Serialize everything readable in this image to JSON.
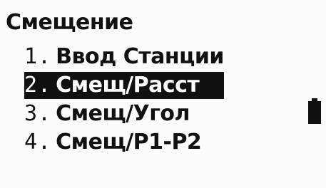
{
  "screen": {
    "title": "Смещение"
  },
  "menu": {
    "items": [
      {
        "number": "1.",
        "label": "Ввод Станции",
        "selected": false
      },
      {
        "number": "2.",
        "label": "Смещ/Расст",
        "selected": true
      },
      {
        "number": "3.",
        "label": "Смещ/Угол",
        "selected": false
      },
      {
        "number": "4.",
        "label": "Смещ/P1-P2",
        "selected": false
      }
    ]
  },
  "status": {
    "battery_icon": "battery-icon"
  }
}
